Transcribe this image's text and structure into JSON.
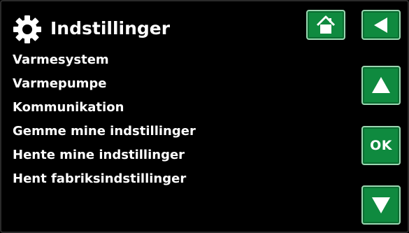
{
  "header": {
    "title": "Indstillinger",
    "icon": "gear-icon"
  },
  "menu": {
    "items": [
      {
        "label": "Varmesystem"
      },
      {
        "label": "Varmepumpe"
      },
      {
        "label": "Kommunikation"
      },
      {
        "label": "Gemme mine indstillinger"
      },
      {
        "label": "Hente mine indstillinger"
      },
      {
        "label": "Hent fabriksindstillinger"
      }
    ]
  },
  "buttons": {
    "home_icon": "home-icon",
    "back_icon": "back-arrow-icon",
    "up_icon": "up-arrow-icon",
    "ok_label": "OK",
    "down_icon": "down-arrow-icon"
  },
  "colors": {
    "background": "#000000",
    "button": "#0f8a3f",
    "button_border": "#9bd7b1",
    "text": "#ffffff"
  }
}
